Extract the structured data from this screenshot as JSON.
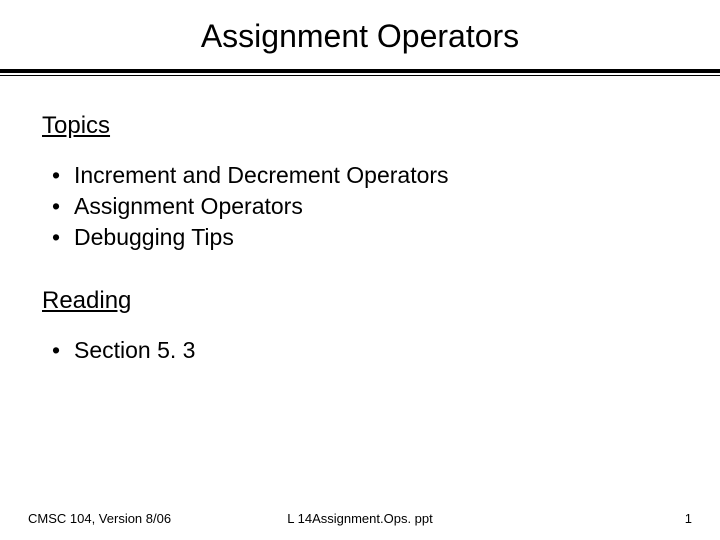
{
  "title": "Assignment Operators",
  "sections": [
    {
      "heading": "Topics",
      "items": [
        "Increment and Decrement Operators",
        "Assignment Operators",
        "Debugging Tips"
      ]
    },
    {
      "heading": "Reading",
      "items": [
        "Section 5. 3"
      ]
    }
  ],
  "footer": {
    "left": "CMSC 104, Version 8/06",
    "center": "L 14Assignment.Ops. ppt",
    "right": "1"
  }
}
